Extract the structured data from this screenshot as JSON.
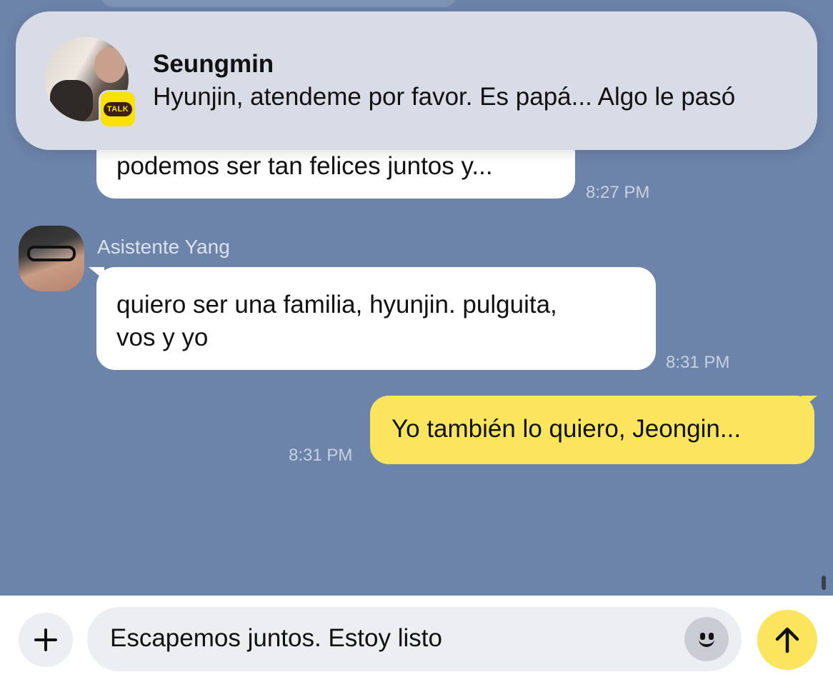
{
  "notification": {
    "app_badge_label": "TALK",
    "sender": "Seungmin",
    "message": "Hyunjin, atendeme por favor. Es papá... Algo le pasó"
  },
  "messages": [
    {
      "direction": "incoming",
      "text": "podemos ser tan felices juntos y...",
      "time": "8:27 PM"
    },
    {
      "direction": "incoming",
      "sender": "Asistente Yang",
      "text_lines": [
        "quiero ser una familia, hyunjin. pulguita,",
        "vos y yo"
      ],
      "time": "8:31 PM"
    },
    {
      "direction": "outgoing",
      "text": "Yo también lo quiero, Jeongin...",
      "time": "8:31 PM"
    }
  ],
  "composer": {
    "plus_icon": "plus-icon",
    "value": "Escapemos juntos. Estoy listo",
    "emoji_icon": "emoji-icon",
    "send_icon": "arrow-up-icon"
  },
  "colors": {
    "chat_background": "#6c83aa",
    "incoming_bubble": "#ffffff",
    "outgoing_bubble": "#fbe55e",
    "kakao_yellow": "#fae100",
    "timestamp": "#c7d1e2"
  }
}
